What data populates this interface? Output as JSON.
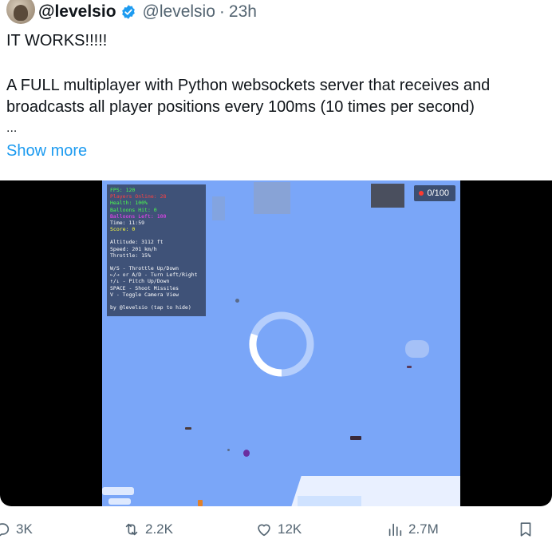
{
  "tweet": {
    "author_name": "@levelsio",
    "handle": "@levelsio",
    "separator": "·",
    "time": "23h",
    "line1": "IT WORKS!!!!!",
    "line2": "A FULL multiplayer with Python websockets server that receives and",
    "line3": "broadcasts all player positions every 100ms (10 times per second)",
    "ellipsis": "...",
    "show_more": "Show more"
  },
  "game": {
    "hud": {
      "fps": "FPS: 120",
      "players_online": "Players Online: 28",
      "health": "Health: 100%",
      "balloons_hit": "Balloons Hit: 0",
      "balloons_left": "Balloons Left: 100",
      "time": "Time: 11:59",
      "score": "Score: 0",
      "altitude": "Altitude: 3112 ft",
      "speed": "Speed: 201 km/h",
      "throttle": "Throttle: 15%",
      "c1": "W/S - Throttle Up/Down",
      "c2": "←/→ or A/D - Turn Left/Right",
      "c3": "↑/↓ - Pitch Up/Down",
      "c4": "SPACE - Shoot Missiles",
      "c5": "V - Toggle Camera View",
      "footer": "by @levelsio (tap to hide)"
    },
    "balloon_counter": "0/100",
    "colors": {
      "sky": "#7aa6f8",
      "fps": "#4cff4c",
      "players_online": "#ff4040",
      "health": "#4cff4c",
      "balloons_hit": "#4cff4c",
      "balloons_left": "#ff40ff",
      "score": "#ffff40"
    }
  },
  "actions": {
    "replies": "3K",
    "reposts": "2.2K",
    "likes": "12K",
    "views": "2.7M"
  },
  "icons": [
    "verified-icon",
    "reply-icon",
    "repost-icon",
    "like-icon",
    "views-icon",
    "bookmark-icon"
  ]
}
